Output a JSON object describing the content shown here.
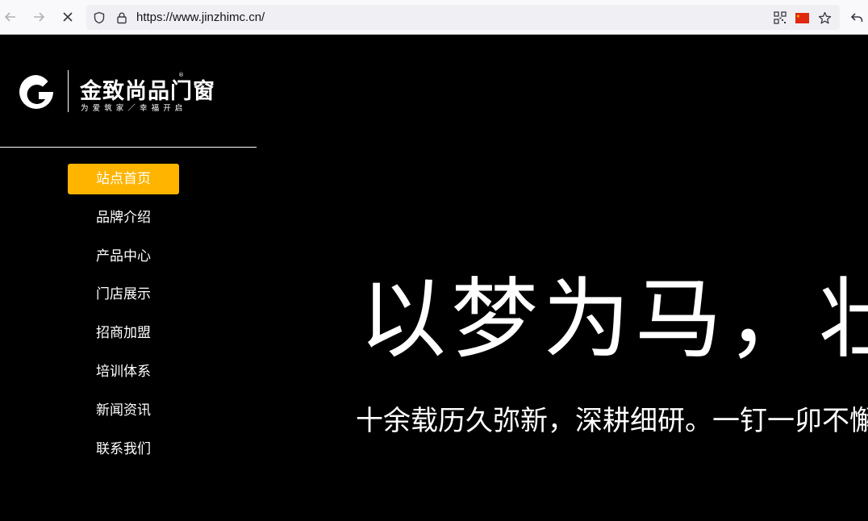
{
  "browser": {
    "url": "https://www.jinzhimc.cn/",
    "back_icon": "arrow-left-icon",
    "forward_icon": "arrow-right-icon",
    "stop_icon": "close-icon",
    "flag_color": "#de2910"
  },
  "logo": {
    "name": "金致尚品门窗",
    "registered": "®",
    "slogan": "为爱筑家／幸福开启"
  },
  "menu": {
    "items": [
      {
        "label": "站点首页",
        "active": true
      },
      {
        "label": "品牌介绍"
      },
      {
        "label": "产品中心"
      },
      {
        "label": "门店展示"
      },
      {
        "label": "招商加盟"
      },
      {
        "label": "培训体系"
      },
      {
        "label": "新闻资讯"
      },
      {
        "label": "联系我们"
      }
    ],
    "accent": "#ffb400"
  },
  "hero": {
    "title": "以梦为马，壮",
    "subtitle": "十余载历久弥新，深耕细研。一钉一卯不懈"
  }
}
